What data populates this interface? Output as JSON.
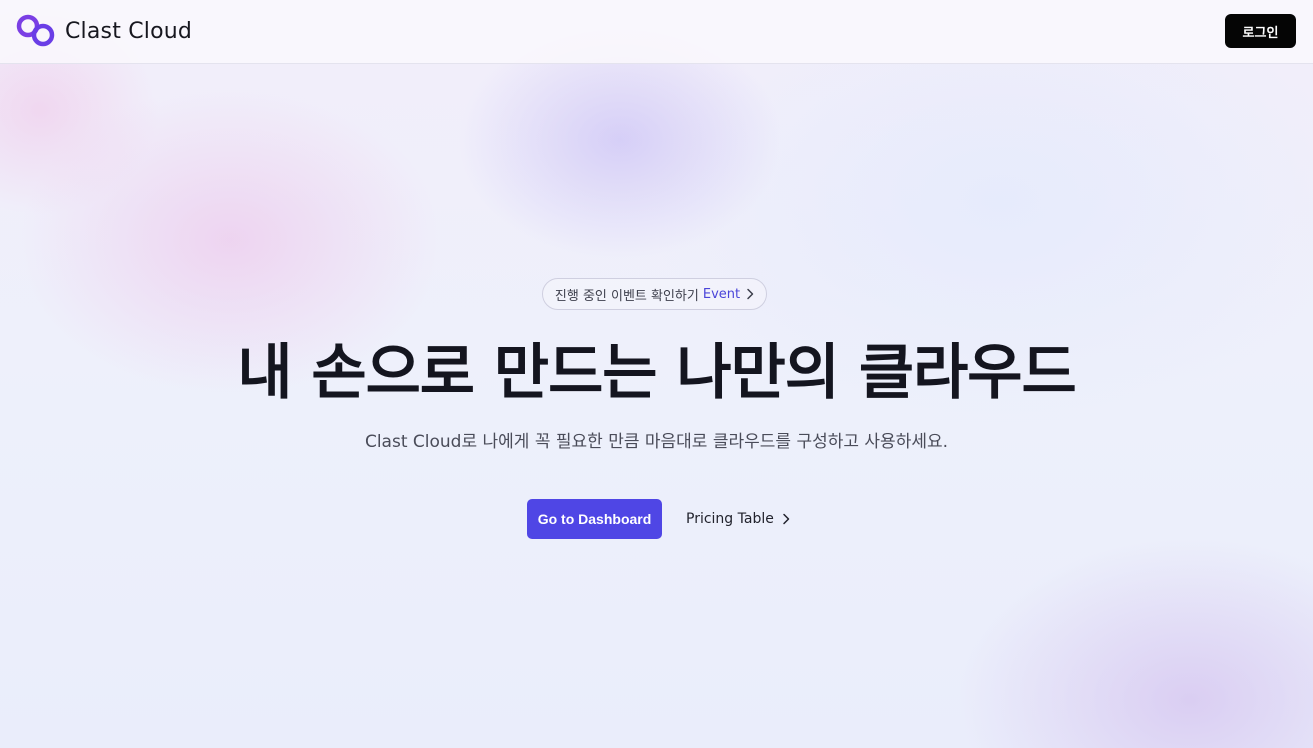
{
  "brand": {
    "name": "Clast Cloud",
    "logo_icon": "linked-rings-icon",
    "logo_color": "#7b3fe4"
  },
  "header": {
    "login_label": "로그인"
  },
  "hero": {
    "event_text": "진행 중인 이벤트 확인하기",
    "event_link": "Event",
    "title": "내 손으로 만드는 나만의 클라우드",
    "subtitle": "Clast Cloud로 나에게 꼭 필요한 만큼 마음대로 클라우드를 구성하고 사용하세요.",
    "primary_cta": "Go to Dashboard",
    "secondary_cta": "Pricing Table"
  },
  "colors": {
    "accent": "#4f46e5",
    "event_link": "#4a45d9",
    "login_bg": "#050505",
    "title": "#14151f"
  }
}
